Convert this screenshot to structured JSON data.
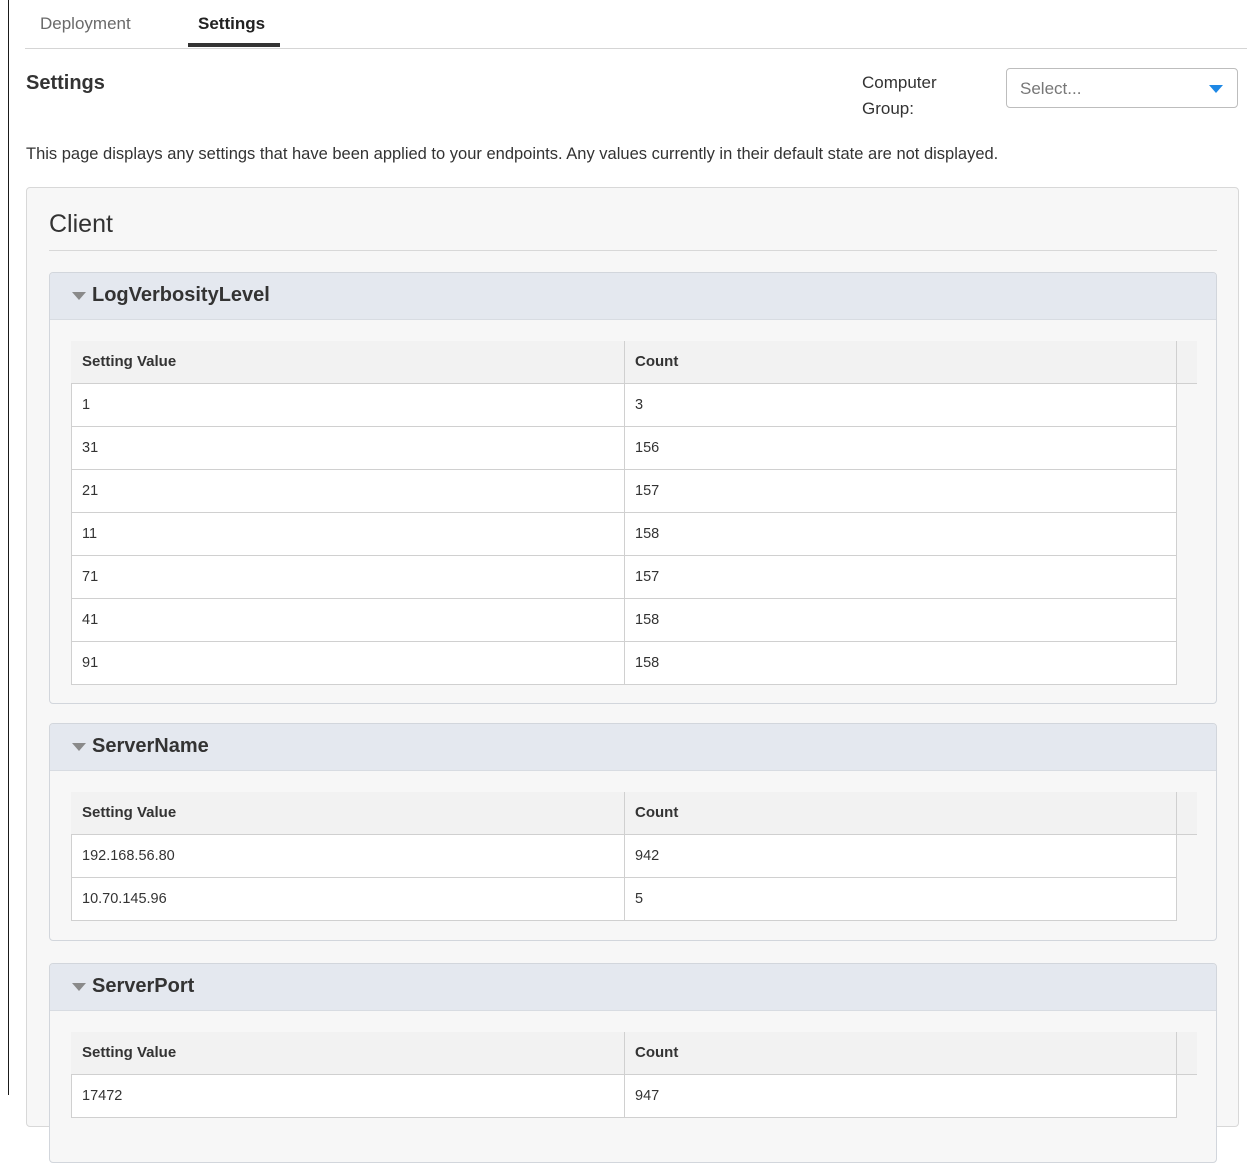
{
  "tabs": [
    {
      "label": "Deployment"
    },
    {
      "label": "Settings"
    }
  ],
  "header": {
    "title": "Settings",
    "computer_group_label": "Computer Group:",
    "computer_group_placeholder": "Select..."
  },
  "description": "This page displays any settings that have been applied to your endpoints. Any values currently in their default state are not displayed.",
  "client": {
    "title": "Client",
    "sections": [
      {
        "name": "LogVerbosityLevel",
        "headers": [
          "Setting Value",
          "Count"
        ],
        "rows": [
          [
            "1",
            "3"
          ],
          [
            "31",
            "156"
          ],
          [
            "21",
            "157"
          ],
          [
            "11",
            "158"
          ],
          [
            "71",
            "157"
          ],
          [
            "41",
            "158"
          ],
          [
            "91",
            "158"
          ]
        ]
      },
      {
        "name": "ServerName",
        "headers": [
          "Setting Value",
          "Count"
        ],
        "rows": [
          [
            "192.168.56.80",
            "942"
          ],
          [
            "10.70.145.96",
            "5"
          ]
        ]
      },
      {
        "name": "ServerPort",
        "headers": [
          "Setting Value",
          "Count"
        ],
        "rows": [
          [
            "17472",
            "947"
          ]
        ]
      }
    ]
  }
}
